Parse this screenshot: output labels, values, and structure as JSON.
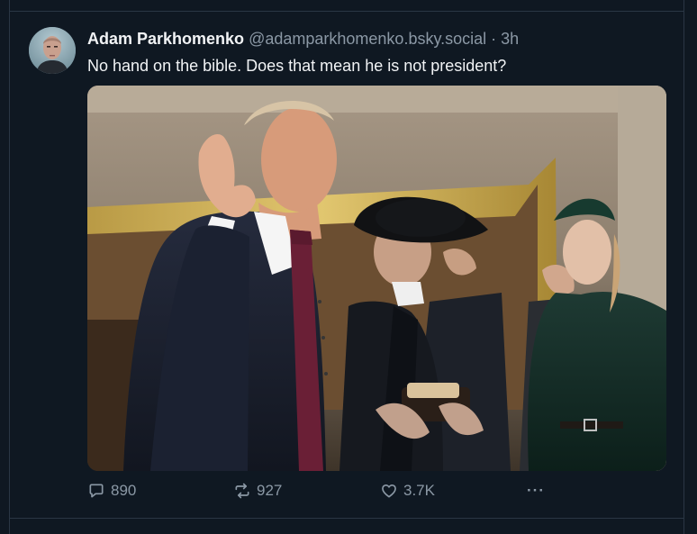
{
  "post": {
    "author_name": "Adam Parkhomenko",
    "handle": "@adamparkhomenko.bsky.social",
    "separator": "·",
    "time": "3h",
    "text": "No hand on the bible. Does that mean he is not president?",
    "avatar_icon": "avatar-photo",
    "media_icon": "inauguration-photo",
    "actions": {
      "replies": "890",
      "reposts": "927",
      "likes": "3.7K",
      "more_label": "···"
    }
  },
  "colors": {
    "background": "#0f1822",
    "text_primary": "#f1f3f5",
    "text_secondary": "#8b98a5",
    "border": "#2a3644"
  }
}
